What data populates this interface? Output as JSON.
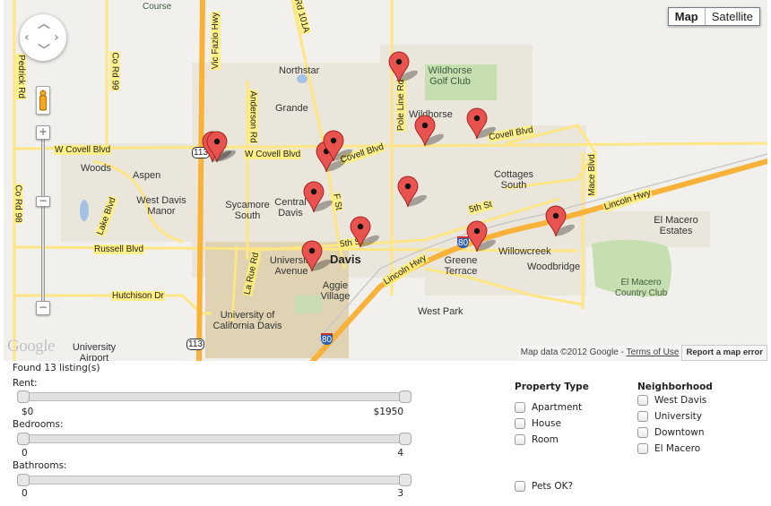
{
  "map": {
    "map_type_buttons": [
      "Map",
      "Satellite"
    ],
    "active_map_type": "Map",
    "attribution": "Map data ©2012 Google - ",
    "terms_link": "Terms of Use",
    "report_button": "Report a map error",
    "logo": "Google",
    "zoom_in": "+",
    "zoom_out": "−",
    "place_labels": [
      "Course",
      "Northstar",
      "Grande",
      "Wildhorse Golf Club",
      "Wildhorse",
      "Woods",
      "Aspen",
      "West Davis Manor",
      "Sycamore South",
      "Central Davis",
      "Cottages South",
      "El Macero Estates",
      "Willowcreek",
      "Woodbridge",
      "El Macero Country Club",
      "Greene Terrace",
      "West Park",
      "University Avenue",
      "Davis",
      "Aggie Village",
      "University of California Davis",
      "University Airport"
    ],
    "road_labels": [
      "Vic Fazio Hwy",
      "Rd 101A",
      "Co Rd 99",
      "Pedrick Rd",
      "Anderson Rd",
      "Pole Line Rd",
      "W Covell Blvd",
      "W Covell Blvd",
      "Covell Blvd",
      "Covell Blvd",
      "Mace Blvd",
      "Lincoln Hwy",
      "Lincoln Hwy",
      "5th St",
      "5th St",
      "F St",
      "Lake Blvd",
      "Russell Blvd",
      "Hutchison Dr",
      "La Rue Rd",
      "Co Rd 98"
    ],
    "highway_shields": [
      "113",
      "113",
      "80",
      "80"
    ],
    "marker_count": 13
  },
  "results": {
    "found_text": "Found 13 listing(s)"
  },
  "filters": {
    "rent": {
      "label": "Rent:",
      "min_label": "$0",
      "max_label": "$1950",
      "min": 0,
      "max": 1950,
      "low": 0,
      "high": 1950
    },
    "bedrooms": {
      "label": "Bedrooms:",
      "min_label": "0",
      "max_label": "4",
      "min": 0,
      "max": 4,
      "low": 0,
      "high": 4
    },
    "bathrooms": {
      "label": "Bathrooms:",
      "min_label": "0",
      "max_label": "3",
      "min": 0,
      "max": 3,
      "low": 0,
      "high": 3
    },
    "property_type": {
      "title": "Property Type",
      "options": [
        {
          "label": "Apartment",
          "checked": false
        },
        {
          "label": "House",
          "checked": false
        },
        {
          "label": "Room",
          "checked": false
        }
      ]
    },
    "neighborhood": {
      "title": "Neighborhood",
      "options": [
        {
          "label": "West Davis",
          "checked": false
        },
        {
          "label": "University",
          "checked": false
        },
        {
          "label": "Downtown",
          "checked": false
        },
        {
          "label": "El Macero",
          "checked": false
        }
      ]
    },
    "pets": {
      "label": "Pets OK?",
      "checked": false
    }
  },
  "colors": {
    "marker": "#e9534f",
    "highway": "#f8b23a",
    "road": "#fde683",
    "map_bg": "#f2f0ec",
    "urban": "#ebe6dc",
    "park": "#c5dfb0",
    "water": "#a4c1e6"
  }
}
